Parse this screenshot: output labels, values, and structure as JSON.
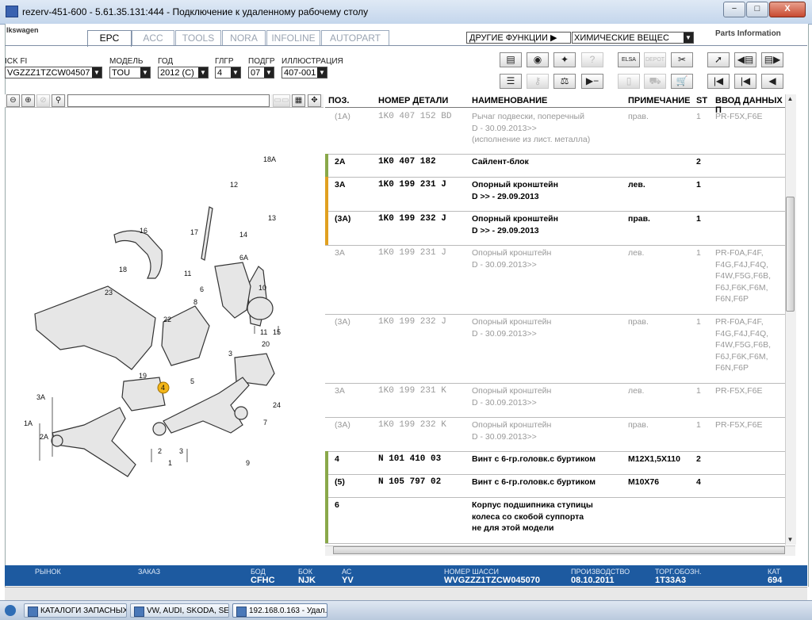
{
  "window": {
    "title": "rezerv-451-600 - 5.61.35.131:444 - Подключение к удаленному рабочему столу",
    "minimize": "−",
    "maximize": "□",
    "close": "X"
  },
  "brand": {
    "left": "lkswagen",
    "right_top": "",
    "right": "Parts Information"
  },
  "tabs": [
    "EPC",
    "ACC",
    "TOOLS",
    "NORA",
    "INFOLINE",
    "AUTOPART"
  ],
  "functions": {
    "other_label": "ДРУГИЕ ФУНКЦИИ ▶",
    "chemical_value": "ХИМИЧЕСКИЕ ВЕЩЕС"
  },
  "filters": [
    {
      "label": "ICK FI",
      "value": "VGZZZ1TZCW04507"
    },
    {
      "label": "МОДЕЛЬ",
      "value": "TOU"
    },
    {
      "label": "ГОД",
      "value": "2012 (C)"
    },
    {
      "label": "ГЛГР",
      "value": "4"
    },
    {
      "label": "ПОДГР",
      "value": "07"
    },
    {
      "label": "ИЛЛЮСТРАЦИЯ",
      "value": "407-001"
    }
  ],
  "toolbar_icons": [
    "print-icon",
    "audio-icon",
    "parts-icon",
    "help-icon",
    "elsa-icon",
    "dealer-icon",
    "scissors-icon",
    "pin-icon",
    "prev-page-icon",
    "next-page-icon",
    "list-icon",
    "key-icon",
    "scale-icon",
    "play-minus-icon",
    "remote-icon",
    "vehicle-icon",
    "cart-icon",
    "first-icon",
    "back-icon",
    "left-icon"
  ],
  "toolbar_labels": {
    "elsa": "ELSA",
    "dealer": "DEPOT"
  },
  "table": {
    "headers": [
      "ПОЗ.",
      "НОМЕР ДЕТАЛИ",
      "НАИМЕНОВАНИЕ",
      "ПРИМЕЧАНИЕ",
      "ST",
      "ВВОД ДАННЫХ П"
    ],
    "rows": [
      {
        "pos": "(1A)",
        "part": "1K0  407  152  BD",
        "name": "Рычаг подвески, поперечный\nD - 30.09.2013>>\n(исполнение из лист. металла)",
        "note": "прав.",
        "st": "1",
        "data": "PR-F5X,F6E",
        "style": "dim"
      },
      {
        "pos": "2A",
        "part": "1K0  407  182",
        "name": "Сайлент-блок",
        "note": "",
        "st": "2",
        "data": "",
        "style": "act"
      },
      {
        "pos": "3A",
        "part": "1K0  199  231  J",
        "name": "Опорный кронштейн\nD            >> - 29.09.2013",
        "note": "лев.",
        "st": "1",
        "data": "",
        "style": "act"
      },
      {
        "pos": "(3A)",
        "part": "1K0  199  232  J",
        "name": "Опорный кронштейн\nD            >> - 29.09.2013",
        "note": "прав.",
        "st": "1",
        "data": "",
        "style": "act"
      },
      {
        "pos": "3A",
        "part": "1K0  199  231  J",
        "name": "Опорный кронштейн\nD - 30.09.2013>>",
        "note": "лев.",
        "st": "1",
        "data": "PR-F0A,F4F,\nF4G,F4J,F4Q,\nF4W,F5G,F6B,\nF6J,F6K,F6M,\nF6N,F6P",
        "style": "dim"
      },
      {
        "pos": "(3A)",
        "part": "1K0  199  232  J",
        "name": "Опорный кронштейн\nD - 30.09.2013>>",
        "note": "прав.",
        "st": "1",
        "data": "PR-F0A,F4F,\nF4G,F4J,F4Q,\nF4W,F5G,F6B,\nF6J,F6K,F6M,\nF6N,F6P",
        "style": "dim"
      },
      {
        "pos": "3A",
        "part": "1K0  199  231  K",
        "name": "Опорный кронштейн\nD - 30.09.2013>>",
        "note": "лев.",
        "st": "1",
        "data": "PR-F5X,F6E",
        "style": "dim"
      },
      {
        "pos": "(3A)",
        "part": "1K0  199  232  K",
        "name": "Опорный кронштейн\nD - 30.09.2013>>",
        "note": "прав.",
        "st": "1",
        "data": "PR-F5X,F6E",
        "style": "dim"
      },
      {
        "pos": "4",
        "part": "N     101  410  03",
        "name": "Винт с 6-гр.головк.с буртиком",
        "note": "M12X1,5X110",
        "st": "2",
        "data": "",
        "style": "act"
      },
      {
        "pos": "(5)",
        "part": "N     105  797  02",
        "name": "Винт с 6-гр.головк.с буртиком",
        "note": "M10X76",
        "st": "4",
        "data": "",
        "style": "act"
      },
      {
        "pos": "6",
        "part": "",
        "name": "Корпус подшипника ступицы\nколеса со скобой суппорта\nне для этой модели",
        "note": "",
        "st": "",
        "data": "",
        "style": "act"
      }
    ]
  },
  "diagram": {
    "labels": [
      "18A",
      "12",
      "13",
      "16",
      "17",
      "14",
      "6A",
      "18",
      "11",
      "6",
      "8",
      "10",
      "23",
      "22",
      "15",
      "11",
      "20",
      "19",
      "5",
      "3",
      "4",
      "3A",
      "1A",
      "2A",
      "24",
      "7",
      "2",
      "3",
      "9",
      "1"
    ]
  },
  "status": [
    {
      "k": "РЫНОК",
      "v": ""
    },
    {
      "k": "ЗАКАЗ",
      "v": ""
    },
    {
      "k": "БОД",
      "v": "CFHC"
    },
    {
      "k": "БОК",
      "v": "NJK"
    },
    {
      "k": "АС",
      "v": "YV"
    },
    {
      "k": "НОМЕР ШАССИ",
      "v": "WVGZZZ1TZCW045070"
    },
    {
      "k": "ПРОИЗВОДСТВО",
      "v": "08.10.2011"
    },
    {
      "k": "ТОРГ.ОБОЗН.",
      "v": "1T33A3"
    },
    {
      "k": "КАТ",
      "v": "694"
    }
  ],
  "taskbar": [
    {
      "label": "КАТАЛОГИ ЗАПАСНЫХ ...",
      "active": false
    },
    {
      "label": "VW, AUDI, SKODA, SEAT",
      "active": false
    },
    {
      "label": "192.168.0.163 - Удал...",
      "active": true
    }
  ],
  "colors": {
    "status_bar": "#1d5aa0",
    "active_bar_green": "#8aa84a",
    "active_bar_orange": "#e0a020"
  }
}
